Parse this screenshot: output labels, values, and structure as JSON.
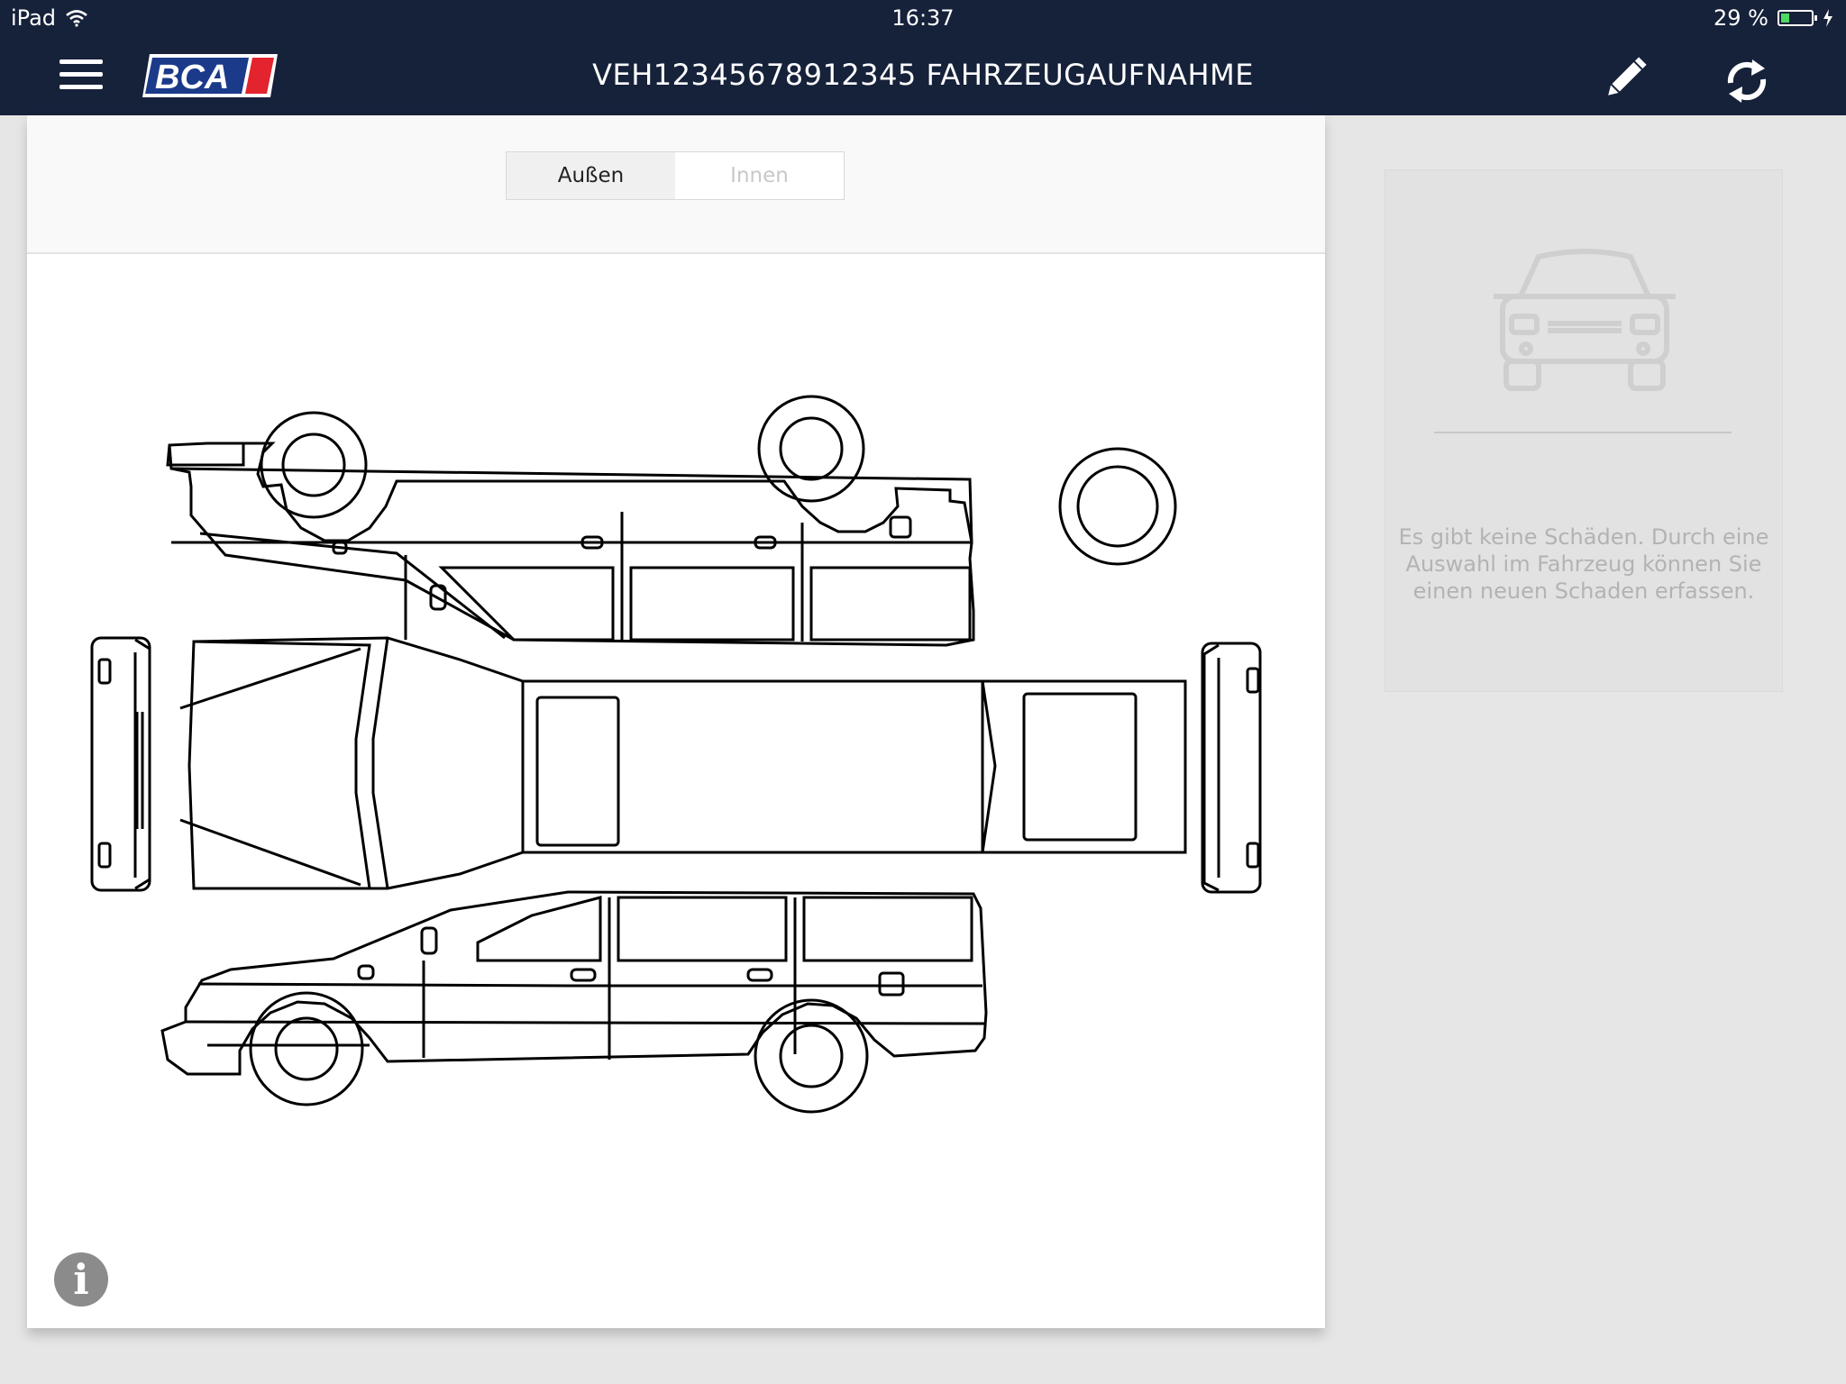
{
  "status_bar": {
    "device": "iPad",
    "time": "16:37",
    "battery_text": "29 %",
    "battery_level": 0.29
  },
  "nav": {
    "logo_text": "BCA",
    "title": "VEH12345678912345 FAHRZEUGAUFNAHME"
  },
  "segments": [
    {
      "label": "Außen",
      "selected": true
    },
    {
      "label": "Innen",
      "selected": false
    }
  ],
  "diagram": {
    "image": "vehicle-damage-diagram-exterior"
  },
  "sidebar": {
    "empty_message": "Es gibt keine Schäden. Durch eine Auswahl im Fahrzeug können Sie einen neuen Schaden erfassen."
  },
  "icons": {
    "menu": "hamburger-menu-icon",
    "edit": "pencil-icon",
    "sync": "refresh-icon",
    "info": "info-icon",
    "wifi": "wifi-icon",
    "battery": "battery-icon",
    "charging": "lightning-icon",
    "placeholder": "car-front-icon"
  },
  "colors": {
    "nav_bg": "#16213a",
    "logo_blue": "#1b3a8a",
    "logo_red": "#e3232d",
    "battery_green": "#4cd964"
  }
}
